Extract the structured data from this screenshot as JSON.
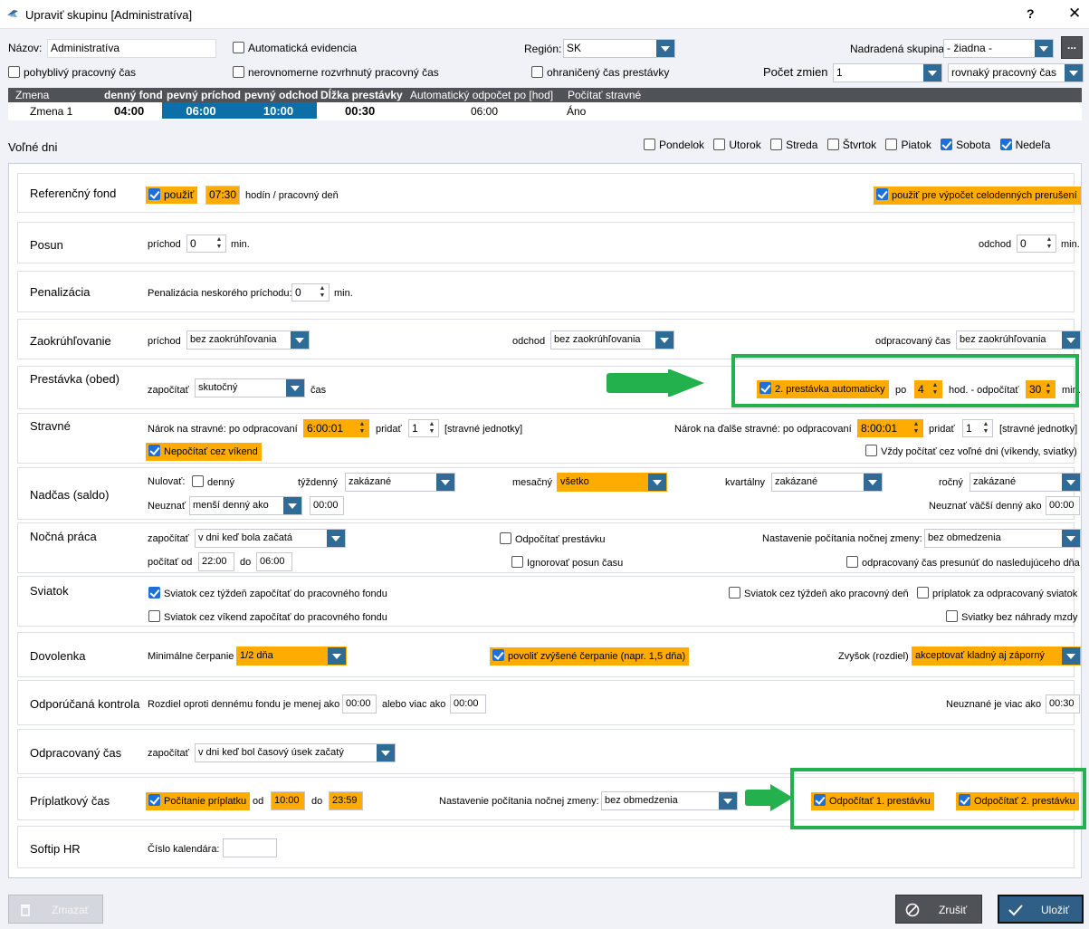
{
  "window": {
    "title": "Upraviť skupinu [Administratíva]",
    "help": "?",
    "close": "✕"
  },
  "top": {
    "nazov_label": "Názov:",
    "nazov_value": "Administratíva",
    "auto_evid": "Automatická evidencia",
    "region_label": "Región:",
    "region_value": "SK",
    "nadradena_label": "Nadradená skupina:",
    "nadradena_value": "- žiadna -",
    "more": "...",
    "pohyblivy": "pohyblivý pracovný čas",
    "nerovnomerne": "nerovnomerne rozvrhnutý pracovný čas",
    "ohraniceny": "ohraničený čas prestávky",
    "pocet_label": "Počet zmien",
    "pocet_value": "1",
    "cas_typ": "rovnaký pracovný čas"
  },
  "grid": {
    "headers": [
      "Zmena",
      "denný fond",
      "pevný príchod",
      "pevný odchod",
      "Dĺžka prestávky",
      "Automatický odpočet po [hod]",
      "Počítať stravné"
    ],
    "row": [
      "Zmena 1",
      "04:00",
      "06:00",
      "10:00",
      "00:30",
      "06:00",
      "Áno"
    ]
  },
  "volne": {
    "label": "Voľné dni",
    "days": [
      {
        "name": "Pondelok",
        "on": false
      },
      {
        "name": "Utorok",
        "on": false
      },
      {
        "name": "Streda",
        "on": false
      },
      {
        "name": "Štvrtok",
        "on": false
      },
      {
        "name": "Piatok",
        "on": false
      },
      {
        "name": "Sobota",
        "on": true
      },
      {
        "name": "Nedeľa",
        "on": true
      }
    ]
  },
  "ref": {
    "label": "Referenčný fond",
    "pouzit": "použiť",
    "value": "07:30",
    "unit": "hodín / pracovný deň",
    "celodenne": "použiť pre výpočet celodenných prerušení"
  },
  "posun": {
    "label": "Posun",
    "prichod": "príchod",
    "prichod_val": "0",
    "min1": "min.",
    "odchod": "odchod",
    "odchod_val": "0",
    "min2": "min."
  },
  "penal": {
    "label": "Penalizácia",
    "text": "Penalizácia neskorého príchodu:",
    "value": "0",
    "min": "min."
  },
  "zaokr": {
    "label": "Zaokrúhľovanie",
    "prichod": "príchod",
    "prichod_val": "bez zaokrúhľovania",
    "odchod": "odchod",
    "odchod_val": "bez zaokrúhľovania",
    "odprac": "odpracovaný čas",
    "odprac_val": "bez zaokrúhľovania"
  },
  "prest": {
    "label": "Prestávka (obed)",
    "zapocitat": "započítať",
    "zap_val": "skutočný",
    "cas": "čas",
    "auto2": "2. prestávka automaticky",
    "po": "po",
    "po_val": "4",
    "hod": "hod. - odpočítať",
    "odp_val": "30",
    "min": "min."
  },
  "strav": {
    "label": "Stravné",
    "narok": "Nárok na stravné: po odpracovaní",
    "narok_val": "6:00:01",
    "pridat": "pridať",
    "pridat_val": "1",
    "jed": "[stravné jednotky]",
    "narok2": "Nárok na ďalše stravné: po odpracovaní",
    "narok2_val": "8:00:01",
    "pridat2": "pridať",
    "pridat2_val": "1",
    "jed2": "[stravné jednotky]",
    "nepocitat": "Nepočítať cez víkend",
    "vzdy": "Vždy počítať cez voľné dni (víkendy, sviatky)"
  },
  "nadcas": {
    "label": "Nadčas (saldo)",
    "nulovat": "Nulovať:",
    "denny": "denný",
    "tyzdenny": "týždenný",
    "tyzdenny_val": "zakázané",
    "mesacny": "mesačný",
    "mesacny_val": "všetko",
    "kvartalny": "kvartálny",
    "kvartalny_val": "zakázané",
    "rocny": "ročný",
    "rocny_val": "zakázané",
    "neuznat": "Neuznať",
    "neuznat_val": "menší denný ako",
    "neuznat_time": "00:00",
    "neuznat2": "Neuznať väčší denný ako",
    "neuznat2_val": "00:00"
  },
  "nocna": {
    "label": "Nočná práca",
    "zapocitat": "započítať",
    "zap_val": "v dni keď bola začatá",
    "odpocitat": "Odpočítať prestávku",
    "nastavenie": "Nastavenie počítania nočnej zmeny:",
    "nast_val": "bez obmedzenia",
    "pocitat_od": "počítať od",
    "od_val": "22:00",
    "do": "do",
    "do_val": "06:00",
    "ignorovat": "Ignorovať posun času",
    "presunut": "odpracovaný čas presunúť do nasledujúceho dňa"
  },
  "sviatok": {
    "label": "Sviatok",
    "c1": "Sviatok cez týždeň započítať do pracovného fondu",
    "c2": "Sviatok cez víkend započítať do pracovného fondu",
    "c3": "Sviatok cez týždeň ako pracovný deň",
    "c4": "príplatok za odpracovaný sviatok",
    "c5": "Sviatky bez náhrady mzdy"
  },
  "dovol": {
    "label": "Dovolenka",
    "min": "Minimálne čerpanie",
    "min_val": "1/2 dňa",
    "povolit": "povoliť zvýšené čerpanie (napr. 1,5 dňa)",
    "zvysok": "Zvyšok (rozdiel)",
    "zvysok_val": "akceptovať kladný aj záporný"
  },
  "kontrola": {
    "label": "Odporúčaná kontrola",
    "rozdiel": "Rozdiel oproti dennému fondu je menej ako",
    "r1": "00:00",
    "alebo": "alebo viac ako",
    "r2": "00:00",
    "neuznane": "Neuznané je viac ako",
    "r3": "00:30"
  },
  "odprac": {
    "label": "Odpracovaný čas",
    "zapocitat": "započítať",
    "val": "v dni keď bol časový úsek  začatý"
  },
  "priplat": {
    "label": "Príplatkový čas",
    "pocitanie": "Počítanie príplatku",
    "od": "od",
    "od_val": "10:00",
    "do": "do",
    "do_val": "23:59",
    "nastavenie": "Nastavenie počítania nočnej zmeny:",
    "nast_val": "bez obmedzenia",
    "odp1": "Odpočítať 1. prestávku",
    "odp2": "Odpočítať 2. prestávku"
  },
  "softip": {
    "label": "Softip HR",
    "cislo": "Číslo kalendára:",
    "cislo_val": ""
  },
  "buttons": {
    "zmazat": "Zmazať",
    "zrusit": "Zrušiť",
    "ulozit": "Uložiť"
  },
  "colors": {
    "accent": "#ffab00",
    "blue": "#2f6b94",
    "green": "#22b14c"
  }
}
